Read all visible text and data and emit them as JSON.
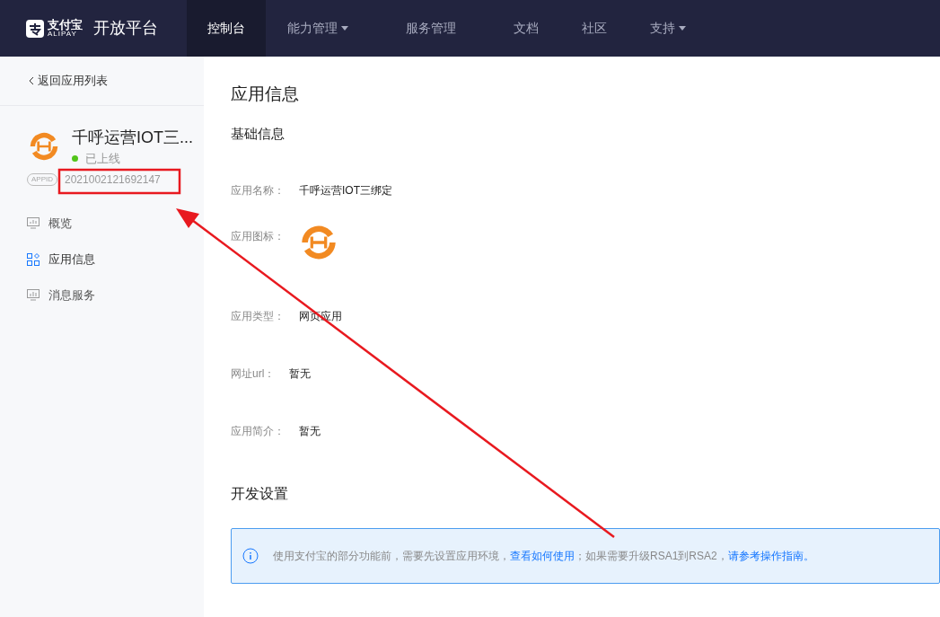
{
  "brand": {
    "name": "支付宝",
    "sub": "ALIPAY",
    "platform": "开放平台"
  },
  "nav": [
    {
      "label": "控制台",
      "selected": true,
      "has_menu": false
    },
    {
      "label": "能力管理",
      "selected": false,
      "has_menu": true
    },
    {
      "label": "服务管理",
      "selected": false,
      "has_menu": false
    },
    {
      "label": "文档",
      "selected": false,
      "has_menu": false
    },
    {
      "label": "社区",
      "selected": false,
      "has_menu": false
    },
    {
      "label": "支持",
      "selected": false,
      "has_menu": true
    }
  ],
  "sidebar": {
    "back": "返回应用列表",
    "app": {
      "name": "千呼运营IOT三...",
      "status": "已上线",
      "online": true,
      "appid_label": "APPID",
      "appid": "2021002121692147"
    },
    "items": [
      {
        "label": "概览",
        "selected": false,
        "kind": "chart"
      },
      {
        "label": "应用信息",
        "selected": true,
        "kind": "grid"
      },
      {
        "label": "消息服务",
        "selected": false,
        "kind": "monitor"
      }
    ]
  },
  "main": {
    "title": "应用信息",
    "section": "基础信息",
    "fields": [
      {
        "label": "应用名称：",
        "kind": "text",
        "value": "千呼运营IOT三绑定"
      },
      {
        "label": "应用图标：",
        "kind": "icon"
      },
      {
        "label": "应用类型：",
        "kind": "text",
        "value": "网页应用"
      },
      {
        "label": "网址url：",
        "kind": "text",
        "value": "暂无"
      },
      {
        "label": "应用简介：",
        "kind": "text",
        "value": "暂无"
      }
    ],
    "section2": "开发设置",
    "notice": [
      {
        "kind": "text",
        "text": "使用支付宝的部分功能前，需要先设置应用环境，"
      },
      {
        "kind": "link",
        "text": "查看如何使用"
      },
      {
        "kind": "text",
        "text": "；如果需要升级RSA1到RSA2，"
      },
      {
        "kind": "link",
        "text": "请参考操作指南。"
      }
    ]
  }
}
